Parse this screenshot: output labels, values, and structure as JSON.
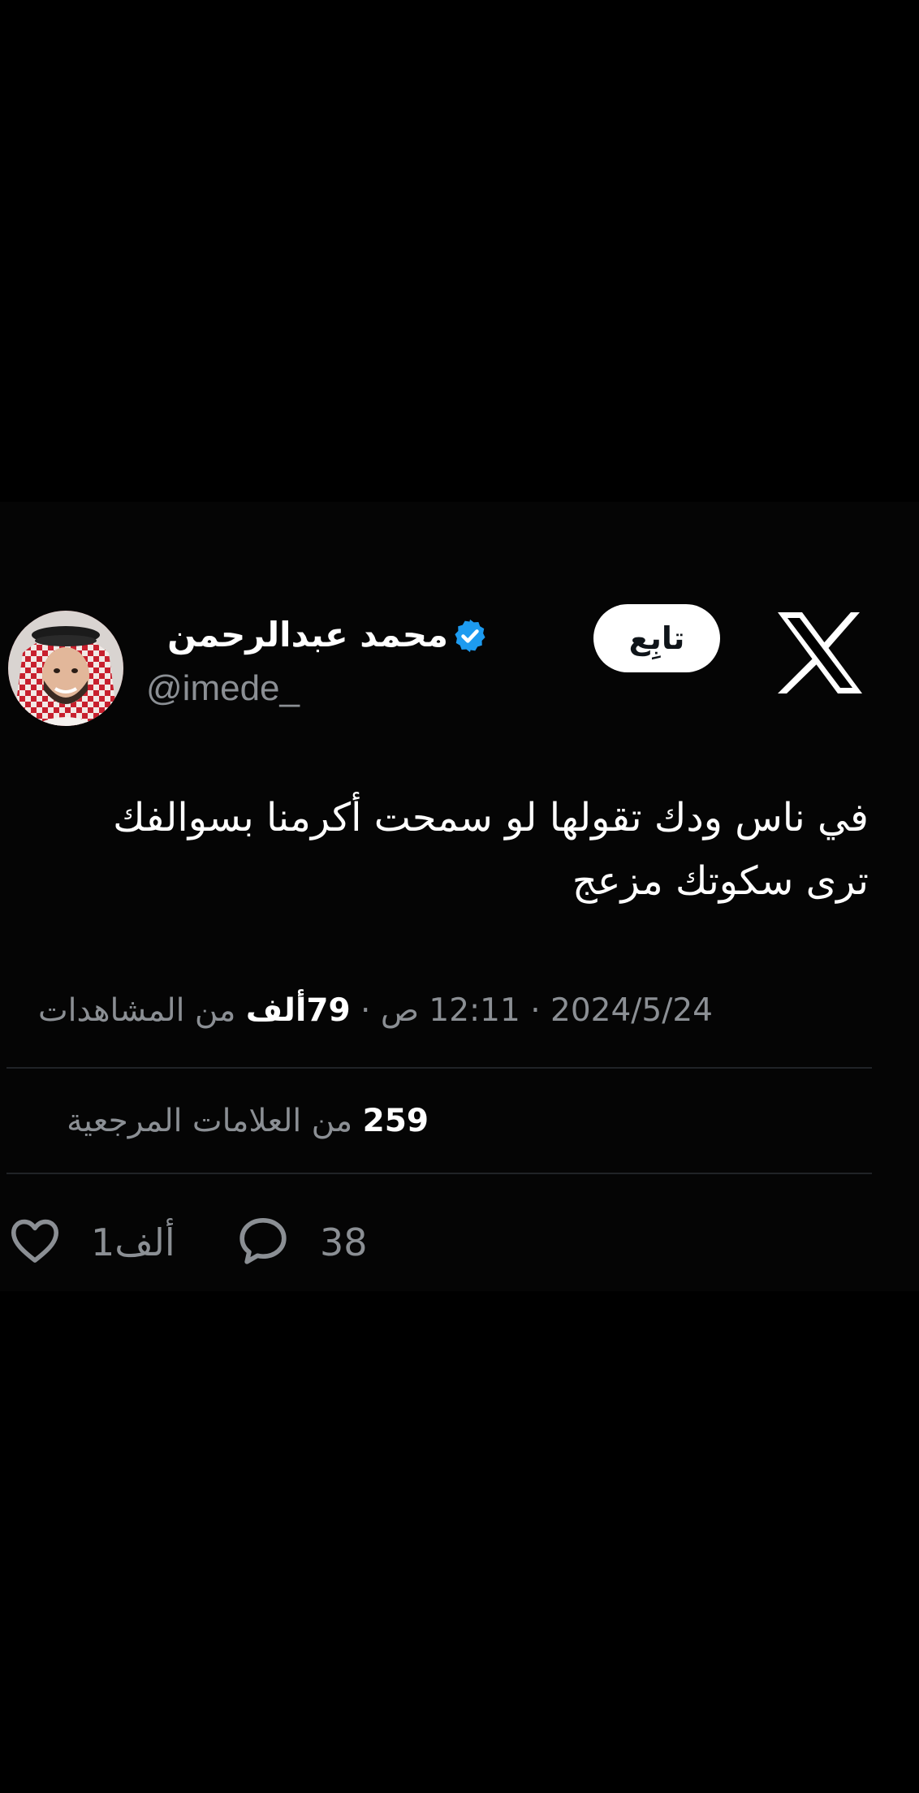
{
  "brand": {
    "logo_icon": "x-logo-icon",
    "accent": "#1d9bf0",
    "background": "#000000"
  },
  "author": {
    "name": "محمد عبدالرحمن",
    "handle": "@imede_",
    "verified": true,
    "avatar_icon": "avatar-photo"
  },
  "follow_button": {
    "label": "تابِع"
  },
  "tweet": {
    "lines": [
      "في ناس ودك تقولها لو سمحت أكرمنا بسوالفك",
      "ترى سكوتك مزعج"
    ]
  },
  "meta": {
    "date": "2024/5/24",
    "separator": "·",
    "time": "12:11 ص",
    "views_count": "79ألف",
    "views_label": "من المشاهدات"
  },
  "bookmarks": {
    "count": "259",
    "label": "من العلامات المرجعية"
  },
  "actions": {
    "replies_count": "38",
    "likes_count": "1ألف",
    "reply_icon": "reply-icon",
    "like_icon": "heart-icon"
  }
}
